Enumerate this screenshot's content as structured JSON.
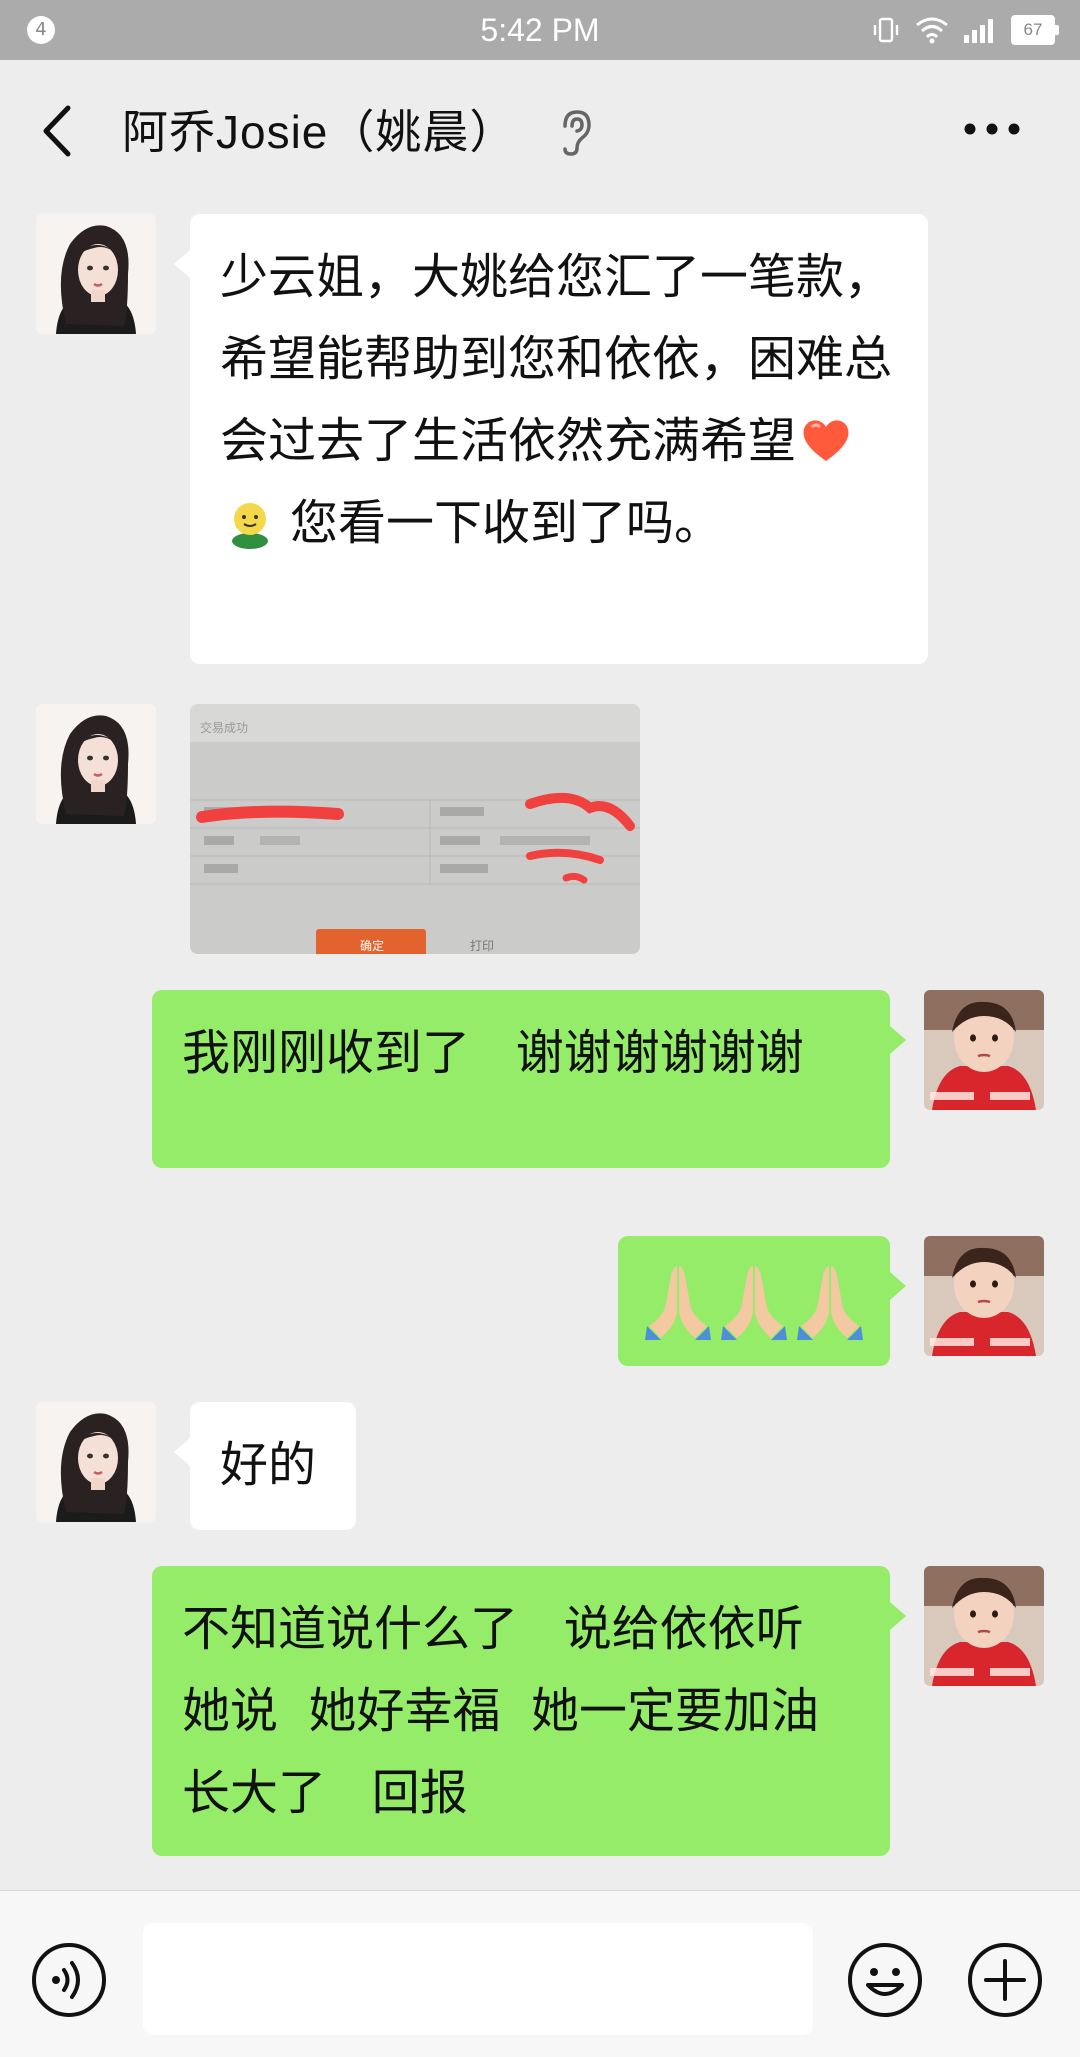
{
  "status_bar": {
    "notification_count": "4",
    "time": "5:42 PM",
    "battery": "67",
    "icons": [
      "vibrate-icon",
      "wifi-icon",
      "signal-icon",
      "battery-icon"
    ]
  },
  "header": {
    "title": "阿乔Josie（姚晨）",
    "back_icon": "chevron-left-icon",
    "ear_icon": "ear-icon",
    "more_icon": "more-horizontal-icon"
  },
  "messages": [
    {
      "direction": "in",
      "type": "text",
      "text": "少云姐，大姚给您汇了一笔款，希望能帮助到您和依依，困难总会过去了生活依然充满希望❤ 🙂 您看一下收到了吗。",
      "text_parts": [
        "少云姐，大姚给您汇了一笔款，希望能帮助到您和依依，困难总会过去了生活依然充满希望",
        "您看一下收到了吗。"
      ],
      "emojis": [
        "heart-emoji",
        "smiley-emoji"
      ]
    },
    {
      "direction": "in",
      "type": "image",
      "image_description_visible_text": [
        "交易成功",
        "确定",
        "打印"
      ]
    },
    {
      "direction": "out",
      "type": "text",
      "text": "我刚刚收到了   谢谢谢谢谢谢"
    },
    {
      "direction": "out",
      "type": "emoji",
      "text": "🙏🙏🙏",
      "emojis": [
        "folded-hands-emoji",
        "folded-hands-emoji",
        "folded-hands-emoji"
      ]
    },
    {
      "direction": "in",
      "type": "text",
      "text": "好的"
    },
    {
      "direction": "out",
      "type": "text",
      "text": "不知道说什么了   说给依依听   她说  她好幸福  她一定要加油   长大了   回报"
    }
  ],
  "colors": {
    "background": "#ededed",
    "outgoing_bubble": "#95ec69",
    "incoming_bubble": "#ffffff",
    "status_bar": "#ababab"
  },
  "input_bar": {
    "placeholder": "",
    "voice_icon": "voice-icon",
    "emoji_icon": "emoji-icon",
    "plus_icon": "plus-circle-icon"
  }
}
